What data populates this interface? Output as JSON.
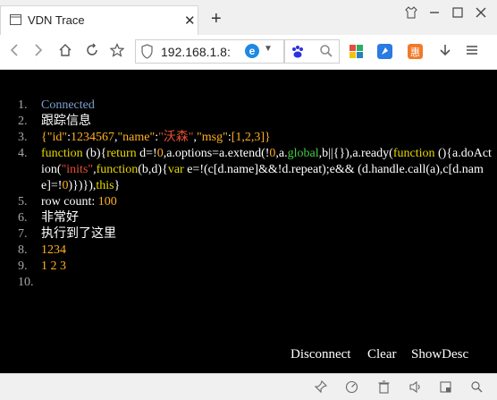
{
  "browser": {
    "tab_title": "VDN Trace",
    "new_tab": "+",
    "close_tab": "✕",
    "url": "192.168.1.8:",
    "search_placeholder": ""
  },
  "console": {
    "lines": [
      {
        "num": "1.",
        "parts": [
          {
            "t": "Connected",
            "c": "c-conn"
          }
        ]
      },
      {
        "num": "2.",
        "parts": [
          {
            "t": "跟踪信息",
            "c": "c-white"
          }
        ]
      },
      {
        "num": "3.",
        "parts": [
          {
            "t": "{",
            "c": "c-orange"
          },
          {
            "t": "\"id\"",
            "c": "c-orange"
          },
          {
            "t": ":",
            "c": "c-white"
          },
          {
            "t": "1234567",
            "c": "c-orange"
          },
          {
            "t": ",",
            "c": "c-white"
          },
          {
            "t": "\"name\"",
            "c": "c-orange"
          },
          {
            "t": ":",
            "c": "c-white"
          },
          {
            "t": "\"沃森\"",
            "c": "c-str"
          },
          {
            "t": ",",
            "c": "c-white"
          },
          {
            "t": "\"msg\"",
            "c": "c-orange"
          },
          {
            "t": ":",
            "c": "c-white"
          },
          {
            "t": "[1,2,3]}",
            "c": "c-orange"
          }
        ]
      },
      {
        "num": "4.",
        "parts": [
          {
            "t": "function",
            "c": "c-yel"
          },
          {
            "t": " (b){",
            "c": "c-white"
          },
          {
            "t": "return",
            "c": "c-yel"
          },
          {
            "t": " d=!",
            "c": "c-white"
          },
          {
            "t": "0",
            "c": "c-orange"
          },
          {
            "t": ",a.options=a.extend(!",
            "c": "c-white"
          },
          {
            "t": "0",
            "c": "c-orange"
          },
          {
            "t": ",a.",
            "c": "c-white"
          },
          {
            "t": "global",
            "c": "c-green"
          },
          {
            "t": ",b||{}),a.ready(",
            "c": "c-white"
          },
          {
            "t": "function",
            "c": "c-yel"
          },
          {
            "t": " (){a.doAction(",
            "c": "c-white"
          },
          {
            "t": "\"inits\"",
            "c": "c-str"
          },
          {
            "t": ",",
            "c": "c-white"
          },
          {
            "t": "function",
            "c": "c-yel"
          },
          {
            "t": "(b,d){",
            "c": "c-white"
          },
          {
            "t": "var",
            "c": "c-yel"
          },
          {
            "t": " e=!(c[d.name]&&!d.repeat);e&& (d.handle.call(a),c[d.name]=!",
            "c": "c-white"
          },
          {
            "t": "0",
            "c": "c-orange"
          },
          {
            "t": ")})}),",
            "c": "c-white"
          },
          {
            "t": "this",
            "c": "c-yel"
          },
          {
            "t": "}",
            "c": "c-white"
          }
        ]
      },
      {
        "num": "5.",
        "parts": [
          {
            "t": "row count: ",
            "c": "c-white"
          },
          {
            "t": "100",
            "c": "c-orange"
          }
        ]
      },
      {
        "num": "6.",
        "parts": [
          {
            "t": "非常好",
            "c": "c-white"
          }
        ]
      },
      {
        "num": "7.",
        "parts": [
          {
            "t": "执行到了这里",
            "c": "c-white"
          }
        ]
      },
      {
        "num": "8.",
        "parts": [
          {
            "t": "1234",
            "c": "c-orange"
          }
        ]
      },
      {
        "num": "9.",
        "parts": [
          {
            "t": "1 2 3",
            "c": "c-orange"
          }
        ]
      },
      {
        "num": "10.",
        "parts": []
      }
    ],
    "actions": {
      "disconnect": "Disconnect",
      "clear": "Clear",
      "showdesc": "ShowDesc"
    }
  },
  "colors": {
    "background": "#000000",
    "connected": "#7f9fcf",
    "number": "#ffb020",
    "keyword": "#e8d800",
    "string": "#e05030",
    "global": "#44cc44"
  }
}
